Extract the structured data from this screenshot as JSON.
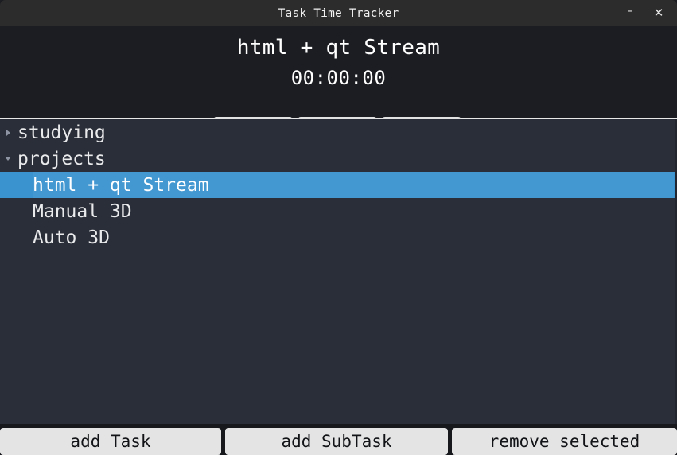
{
  "window": {
    "title": "Task Time Tracker",
    "controls": [
      {
        "name": "minimize",
        "glyph": "–"
      },
      {
        "name": "close",
        "glyph": "✕"
      }
    ]
  },
  "header": {
    "current_task": "html + qt Stream",
    "elapsed_time": "00:00:00",
    "controls": [
      {
        "name": "decrement-button",
        "label": "-"
      },
      {
        "name": "start-button",
        "label": ">"
      },
      {
        "name": "increment-button",
        "label": "+"
      }
    ]
  },
  "tree": {
    "rows": [
      {
        "label": "studying",
        "depth": 0,
        "arrow": "collapsed",
        "selected": false
      },
      {
        "label": "projects",
        "depth": 0,
        "arrow": "expanded",
        "selected": false
      },
      {
        "label": "html + qt Stream",
        "depth": 1,
        "arrow": "none",
        "selected": true
      },
      {
        "label": "Manual 3D",
        "depth": 1,
        "arrow": "none",
        "selected": false
      },
      {
        "label": "Auto 3D",
        "depth": 1,
        "arrow": "none",
        "selected": false
      }
    ]
  },
  "bottom": {
    "add_task_label": "add Task",
    "add_subtask_label": "add SubTask",
    "remove_selected_label": "remove selected"
  },
  "colors": {
    "window_bg": "#1b1d22",
    "titlebar_bg": "#2c2c2c",
    "tree_bg": "#2a2e38",
    "selection": "#3a93cf",
    "button_face": "#e2e2e2",
    "text_light": "#e9eaec"
  }
}
